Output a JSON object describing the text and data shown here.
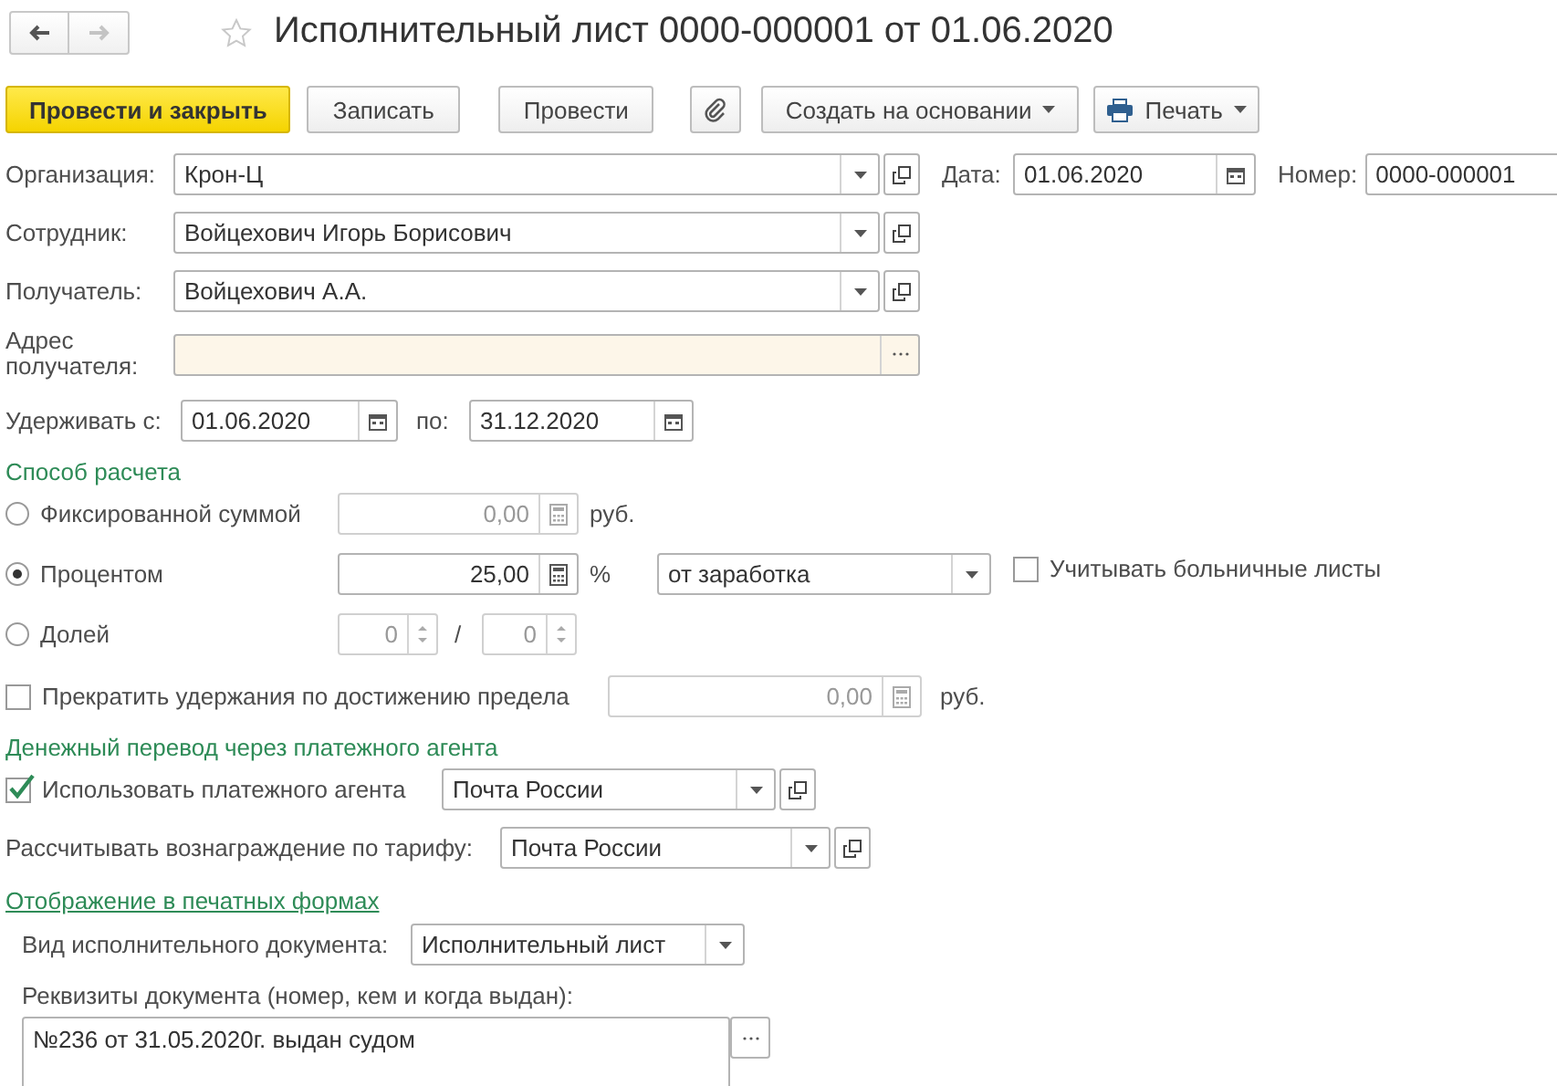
{
  "title": "Исполнительный лист 0000-000001 от 01.06.2020",
  "nav": [
    {
      "kind": "back",
      "disabled": false
    },
    {
      "kind": "forward",
      "disabled": true
    }
  ],
  "toolbar": [
    {
      "kind": "primary",
      "label": "Провести и закрыть"
    },
    {
      "kind": "plain",
      "label": "Записать"
    },
    {
      "kind": "plain",
      "label": "Провести"
    },
    {
      "kind": "attach"
    },
    {
      "kind": "menu",
      "label": "Создать на основании"
    },
    {
      "kind": "print",
      "label": "Печать"
    }
  ],
  "organization": {
    "label": "Организация:",
    "value": "Крон-Ц"
  },
  "date": {
    "label": "Дата:",
    "value": "01.06.2020"
  },
  "number": {
    "label": "Номер:",
    "value": "0000-000001"
  },
  "employee": {
    "label": "Сотрудник:",
    "value": "Войцехович Игорь Борисович"
  },
  "recipient": {
    "label": "Получатель:",
    "value": "Войцехович А.А."
  },
  "address": {
    "label": "Адрес получателя:"
  },
  "withhold": {
    "label": "Удерживать с:",
    "from": "01.06.2020",
    "to_label": "по:",
    "to": "31.12.2020"
  },
  "calc_method": {
    "title": "Способ расчета",
    "options": [
      {
        "kind": "amount",
        "label": "Фиксированной суммой",
        "selected": false,
        "value": "0,00",
        "unit": "руб."
      },
      {
        "kind": "percent",
        "label": "Процентом",
        "selected": true,
        "value": "25,00",
        "unit": "%",
        "base": "от заработка",
        "sick_leave": {
          "label": "Учитывать больничные листы",
          "checked": false
        }
      },
      {
        "kind": "share",
        "label": "Долей",
        "selected": false,
        "numerator": "0",
        "separator": "/",
        "denominator": "0"
      }
    ],
    "limit": {
      "label": "Прекратить удержания по достижению предела",
      "checked": false,
      "value": "0,00",
      "unit": "руб."
    }
  },
  "payment_agent": {
    "title": "Денежный перевод через платежного агента",
    "use": {
      "label": "Использовать платежного агента",
      "checked": true,
      "value": "Почта России"
    },
    "tariff": {
      "label": "Рассчитывать вознаграждение по тарифу:",
      "value": "Почта России"
    }
  },
  "print_forms": {
    "link": "Отображение в печатных формах",
    "doc_type": {
      "label": "Вид исполнительного документа:",
      "value": "Исполнительный лист"
    },
    "details": {
      "label": "Реквизиты документа (номер, кем и когда выдан):",
      "value": "№236 от 31.05.2020г. выдан судом"
    }
  }
}
